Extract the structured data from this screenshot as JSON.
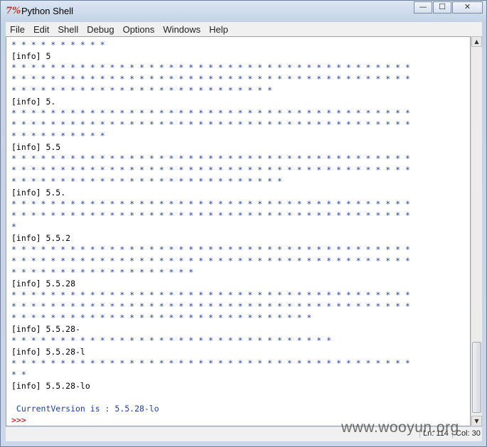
{
  "window": {
    "title": "Python Shell",
    "icon_glyph": "7%",
    "controls": {
      "minimize": "—",
      "maximize": "☐",
      "close": "✕"
    }
  },
  "menu": [
    "File",
    "Edit",
    "Shell",
    "Debug",
    "Options",
    "Windows",
    "Help"
  ],
  "shell_lines": [
    {
      "type": "stars",
      "text": "* * * * * * * * * *"
    },
    {
      "type": "info",
      "text": "[info] 5"
    },
    {
      "type": "stars",
      "text": "* * * * * * * * * * * * * * * * * * * * * * * * * * * * * * * * * * * * * * * * *"
    },
    {
      "type": "stars",
      "text": "* * * * * * * * * * * * * * * * * * * * * * * * * * * * * * * * * * * * * * * * *"
    },
    {
      "type": "stars",
      "text": "* * * * * * * * * * * * * * * * * * * * * * * * * * *"
    },
    {
      "type": "info",
      "text": "[info] 5."
    },
    {
      "type": "stars",
      "text": "* * * * * * * * * * * * * * * * * * * * * * * * * * * * * * * * * * * * * * * * *"
    },
    {
      "type": "stars",
      "text": "* * * * * * * * * * * * * * * * * * * * * * * * * * * * * * * * * * * * * * * * *"
    },
    {
      "type": "stars",
      "text": "* * * * * * * * * *"
    },
    {
      "type": "info",
      "text": "[info] 5.5"
    },
    {
      "type": "stars",
      "text": "* * * * * * * * * * * * * * * * * * * * * * * * * * * * * * * * * * * * * * * * *"
    },
    {
      "type": "stars",
      "text": "* * * * * * * * * * * * * * * * * * * * * * * * * * * * * * * * * * * * * * * * *"
    },
    {
      "type": "stars",
      "text": "* * * * * * * * * * * * * * * * * * * * * * * * * * * *"
    },
    {
      "type": "info",
      "text": "[info] 5.5."
    },
    {
      "type": "stars",
      "text": "* * * * * * * * * * * * * * * * * * * * * * * * * * * * * * * * * * * * * * * * *"
    },
    {
      "type": "stars",
      "text": "* * * * * * * * * * * * * * * * * * * * * * * * * * * * * * * * * * * * * * * * *"
    },
    {
      "type": "stars",
      "text": "*"
    },
    {
      "type": "info",
      "text": "[info] 5.5.2"
    },
    {
      "type": "stars",
      "text": "* * * * * * * * * * * * * * * * * * * * * * * * * * * * * * * * * * * * * * * * *"
    },
    {
      "type": "stars",
      "text": "* * * * * * * * * * * * * * * * * * * * * * * * * * * * * * * * * * * * * * * * *"
    },
    {
      "type": "stars",
      "text": "* * * * * * * * * * * * * * * * * * *"
    },
    {
      "type": "info",
      "text": "[info] 5.5.28"
    },
    {
      "type": "stars",
      "text": "* * * * * * * * * * * * * * * * * * * * * * * * * * * * * * * * * * * * * * * * *"
    },
    {
      "type": "stars",
      "text": "* * * * * * * * * * * * * * * * * * * * * * * * * * * * * * * * * * * * * * * * *"
    },
    {
      "type": "stars",
      "text": "* * * * * * * * * * * * * * * * * * * * * * * * * * * * * * *"
    },
    {
      "type": "info",
      "text": "[info] 5.5.28-"
    },
    {
      "type": "stars",
      "text": "* * * * * * * * * * * * * * * * * * * * * * * * * * * * * * * * *"
    },
    {
      "type": "info",
      "text": "[info] 5.5.28-l"
    },
    {
      "type": "stars",
      "text": "* * * * * * * * * * * * * * * * * * * * * * * * * * * * * * * * * * * * * * * * *"
    },
    {
      "type": "stars",
      "text": "* *"
    },
    {
      "type": "info",
      "text": "[info] 5.5.28-lo"
    },
    {
      "type": "blank",
      "text": ""
    },
    {
      "type": "output",
      "text": " CurrentVersion is : 5.5.28-lo"
    },
    {
      "type": "prompt",
      "text": ">>>"
    }
  ],
  "status": {
    "line": "Ln: 114",
    "col": "Col: 30"
  },
  "watermark": "www.wooyun.org",
  "colors": {
    "stars": "#1c3fa6",
    "info": "#000000",
    "output": "#1c3fa6",
    "prompt": "#b00000",
    "icon": "#c0392b"
  },
  "scrollbar": {
    "up_icon": "up-arrow-icon",
    "down_icon": "down-arrow-icon",
    "position_fraction": 0.87
  }
}
